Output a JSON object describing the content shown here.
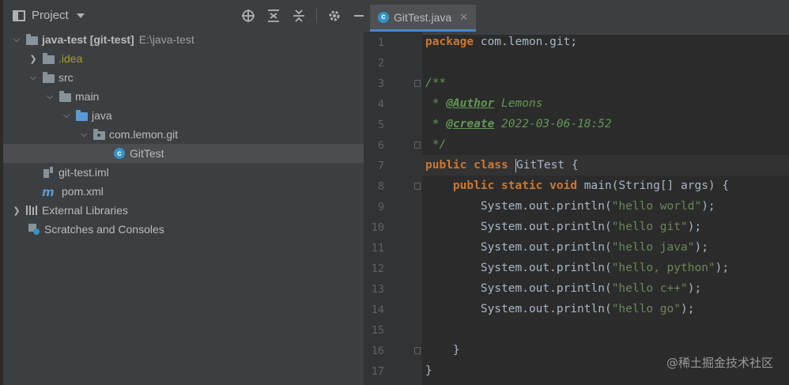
{
  "project_panel": {
    "title": "Project",
    "tree": [
      {
        "level": 0,
        "expanded": true,
        "icon": "module-folder-icon",
        "label": "java-test",
        "suffix": "[git-test]",
        "path": "E:\\java-test"
      },
      {
        "level": 1,
        "expanded": false,
        "icon": "folder-icon",
        "label": ".idea"
      },
      {
        "level": 1,
        "expanded": true,
        "icon": "folder-icon",
        "label": "src"
      },
      {
        "level": 2,
        "expanded": true,
        "icon": "folder-icon",
        "label": "main"
      },
      {
        "level": 3,
        "expanded": true,
        "icon": "source-folder-icon",
        "label": "java"
      },
      {
        "level": 4,
        "expanded": true,
        "icon": "package-icon",
        "label": "com.lemon.git"
      },
      {
        "level": 5,
        "icon": "java-class-icon",
        "label": "GitTest",
        "selected": true
      },
      {
        "level": 1,
        "icon": "iml-file-icon",
        "label": "git-test.iml"
      },
      {
        "level": 1,
        "icon": "maven-icon",
        "label": "pom.xml"
      },
      {
        "level": 0,
        "expanded": false,
        "icon": "libraries-icon",
        "label": "External Libraries"
      },
      {
        "level": 0,
        "icon": "scratches-icon",
        "label": "Scratches and Consoles"
      }
    ]
  },
  "editor": {
    "tab_label": "GitTest.java",
    "line_numbers": [
      "1",
      "2",
      "3",
      "4",
      "5",
      "6",
      "7",
      "8",
      "9",
      "10",
      "11",
      "12",
      "13",
      "14",
      "15",
      "16",
      "17"
    ],
    "code": {
      "l1_kw": "package",
      "l1_rest": " com.lemon.git;",
      "l3": "/**",
      "l4_star": " * ",
      "l4_tag": "@Author",
      "l4_val": " Lemons",
      "l5_star": " * ",
      "l5_tag": "@create",
      "l5_val": " 2022-03-06-18:52",
      "l6": " */",
      "l7_kw": "public class ",
      "l7_name": "GitTest {",
      "l8_kw": "    public static void ",
      "l8_rest": "main(String[] args) {",
      "prints": [
        {
          "pre": "        System.out.println(",
          "str": "\"hello world\"",
          "post": ");"
        },
        {
          "pre": "        System.out.println(",
          "str": "\"hello git\"",
          "post": ");"
        },
        {
          "pre": "        System.out.println(",
          "str": "\"hello java\"",
          "post": ");"
        },
        {
          "pre": "        System.out.println(",
          "str": "\"hello, python\"",
          "post": ");"
        },
        {
          "pre": "        System.out.println(",
          "str": "\"hello c++\"",
          "post": ");"
        },
        {
          "pre": "        System.out.println(",
          "str": "\"hello go\"",
          "post": ");"
        }
      ],
      "l16": "    }",
      "l17": "}"
    }
  },
  "watermark": "@稀土掘金技术社区",
  "colors": {
    "keyword": "#cc7832",
    "string": "#6a8759",
    "doc": "#629755",
    "text": "#a9b7c6"
  }
}
